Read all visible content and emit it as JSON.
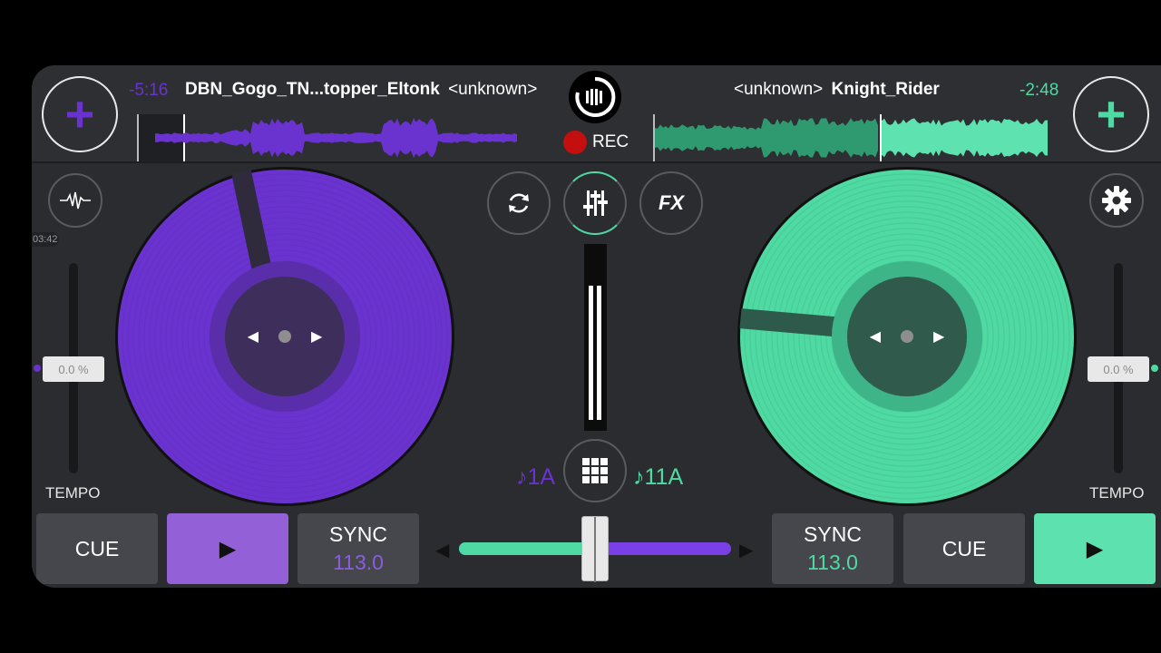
{
  "colors": {
    "deck_a": "#6a32cf",
    "deck_b": "#4fdaa3",
    "rec": "#c40f0f",
    "background": "#2b2c30"
  },
  "side_overlay": {
    "time": "03:42"
  },
  "deck_a": {
    "remaining_time": "-5:16",
    "title": "DBN_Gogo_TN...topper_Eltonk",
    "artist": "<unknown>",
    "add_icon": "plus-icon",
    "tool_icon": "waveform-icon",
    "tempo_value": "0.0 %",
    "tempo_label": "TEMPO",
    "cue_label": "CUE",
    "play_icon": "play-icon",
    "sync_label": "SYNC",
    "bpm": "113.0",
    "key": "♪1A"
  },
  "deck_b": {
    "remaining_time": "-2:48",
    "title": "Knight_Rider",
    "artist": "<unknown>",
    "add_icon": "plus-icon",
    "tool_icon": "gear-icon",
    "tempo_value": "0.0 %",
    "tempo_label": "TEMPO",
    "cue_label": "CUE",
    "play_icon": "play-icon",
    "sync_label": "SYNC",
    "bpm": "113.0",
    "key": "♪11A"
  },
  "center": {
    "rec_label": "REC",
    "fx_label": "FX",
    "icons": [
      "sync-loop-icon",
      "mixer-icon",
      "grid-icon"
    ]
  },
  "crossfader": {
    "position": 0.5
  }
}
